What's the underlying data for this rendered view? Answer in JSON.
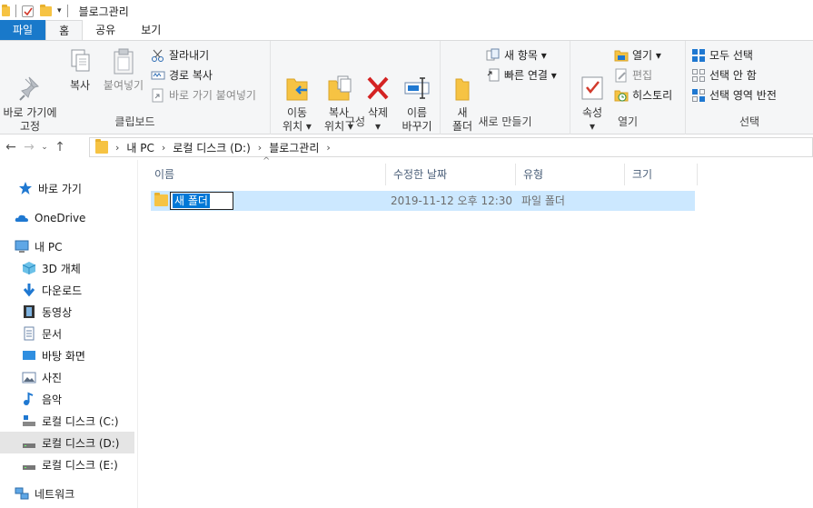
{
  "window": {
    "title": "블로그관리"
  },
  "tabs": [
    {
      "label": "파일"
    },
    {
      "label": "홈"
    },
    {
      "label": "공유"
    },
    {
      "label": "보기"
    }
  ],
  "ribbon": {
    "clipboard": {
      "group_label": "클립보드",
      "pin_quick_access": "바로 가기에\n고정",
      "copy": "복사",
      "paste": "붙여넣기",
      "cut": "잘라내기",
      "copy_path": "경로 복사",
      "paste_shortcut": "바로 가기 붙여넣기"
    },
    "organize": {
      "group_label": "구성",
      "move_to": "이동\n위치 ▾",
      "copy_to": "복사\n위치 ▾",
      "delete": "삭제\n▾",
      "rename": "이름\n바꾸기"
    },
    "new": {
      "group_label": "새로 만들기",
      "new_folder": "새\n폴더",
      "new_item": "새 항목 ▾",
      "easy_access": "빠른 연결 ▾"
    },
    "open": {
      "group_label": "열기",
      "properties": "속성\n▾",
      "open": "열기 ▾",
      "edit": "편집",
      "history": "히스토리"
    },
    "select": {
      "group_label": "선택",
      "select_all": "모두 선택",
      "select_none": "선택 안 함",
      "invert_selection": "선택 영역 반전"
    }
  },
  "address": {
    "crumbs": [
      "내 PC",
      "로컬 디스크 (D:)",
      "블로그관리"
    ]
  },
  "nav": {
    "items": [
      {
        "label": "바로 가기",
        "icon": "star-icon"
      },
      {
        "label": "OneDrive",
        "icon": "cloud-icon"
      },
      {
        "label": "내 PC",
        "icon": "computer-icon"
      },
      {
        "label": "3D 개체",
        "icon": "cube-icon"
      },
      {
        "label": "다운로드",
        "icon": "download-icon"
      },
      {
        "label": "동영상",
        "icon": "video-icon"
      },
      {
        "label": "문서",
        "icon": "document-icon"
      },
      {
        "label": "바탕 화면",
        "icon": "desktop-icon"
      },
      {
        "label": "사진",
        "icon": "picture-icon"
      },
      {
        "label": "음악",
        "icon": "music-icon"
      },
      {
        "label": "로컬 디스크 (C:)",
        "icon": "drive-icon"
      },
      {
        "label": "로컬 디스크 (D:)",
        "icon": "drive-icon"
      },
      {
        "label": "로컬 디스크 (E:)",
        "icon": "drive-icon"
      },
      {
        "label": "네트워크",
        "icon": "network-icon"
      }
    ]
  },
  "filelist": {
    "columns": [
      "이름",
      "수정한 날짜",
      "유형",
      "크기"
    ],
    "rows": [
      {
        "name": "새 폴더",
        "modified": "2019-11-12 오후 12:30",
        "type": "파일 폴더",
        "size": ""
      }
    ]
  },
  "colors": {
    "accent": "#1979ca",
    "selection": "#cce8ff",
    "folder": "#f6c343"
  }
}
